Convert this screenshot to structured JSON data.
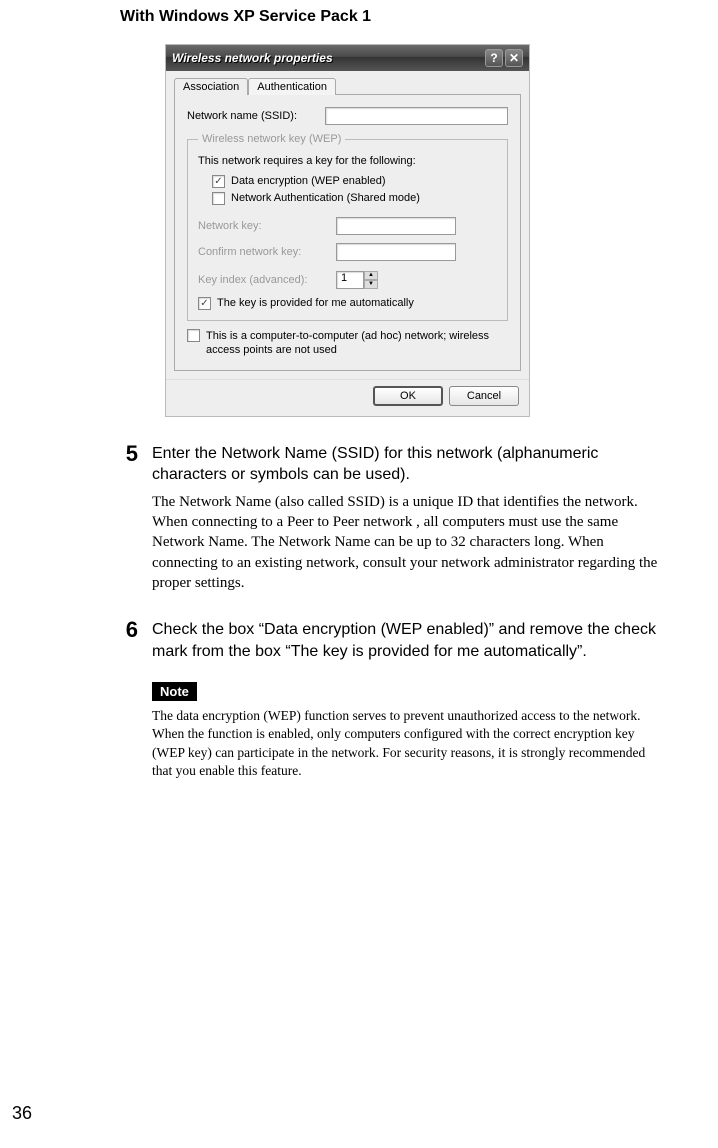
{
  "heading": "With Windows XP Service Pack 1",
  "dialog": {
    "title": "Wireless network properties",
    "help_glyph": "?",
    "close_glyph": "✕",
    "tabs": {
      "association": "Association",
      "authentication": "Authentication"
    },
    "ssid_label": "Network name (SSID):",
    "ssid_value": "",
    "wep_group_legend": "Wireless network key (WEP)",
    "wep_intro": "This network requires a key for the following:",
    "chk_data_encryption": "Data encryption (WEP enabled)",
    "chk_net_auth": "Network Authentication (Shared mode)",
    "net_key_label": "Network key:",
    "confirm_key_label": "Confirm network key:",
    "key_index_label": "Key index (advanced):",
    "key_index_value": "1",
    "chk_auto_key": "The key is provided for me automatically",
    "chk_adhoc": "This is a computer-to-computer (ad hoc) network; wireless access points are not used",
    "ok": "OK",
    "cancel": "Cancel"
  },
  "steps": {
    "five": {
      "num": "5",
      "title": "Enter the Network Name (SSID) for this network (alphanumeric characters or symbols can be used).",
      "para": "The Network Name (also called SSID) is a unique ID that identifies the network. When connecting to a Peer to Peer network , all computers must use the same Network Name. The Network Name can be up to 32 characters long. When connecting to an existing network, consult your network administrator regarding the proper settings."
    },
    "six": {
      "num": "6",
      "title": "Check the box “Data encryption (WEP enabled)” and remove the check mark from the box “The key is provided for me automatically”.",
      "note_label": "Note",
      "note_para": "The data encryption (WEP) function serves to prevent unauthorized access to the network. When the function is enabled, only computers configured with the correct encryption key (WEP key) can participate in the network. For security reasons, it is strongly recommended that you enable this feature."
    }
  },
  "page_number": "36"
}
